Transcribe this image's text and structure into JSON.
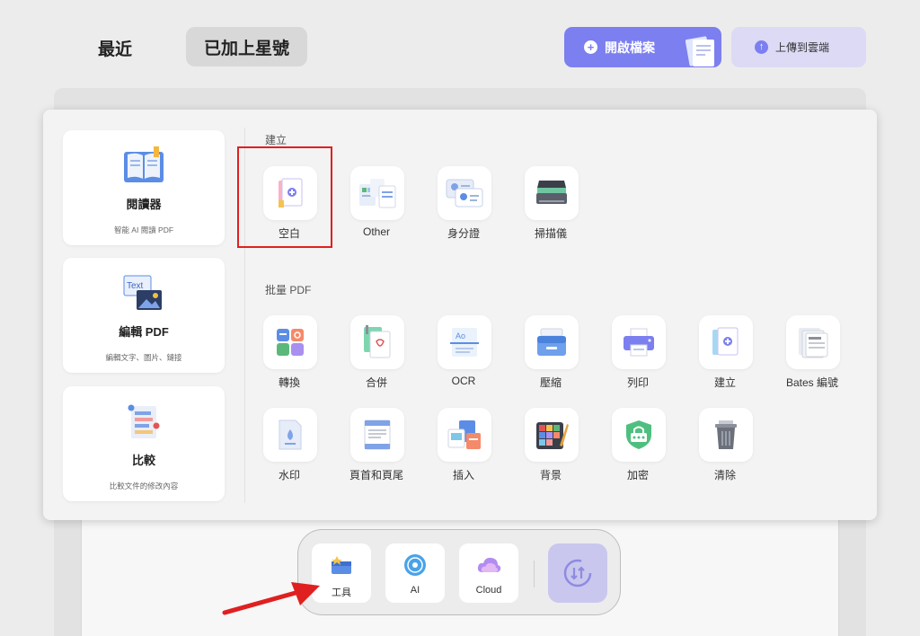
{
  "header": {
    "tab_recent": "最近",
    "tab_starred": "已加上星號",
    "open_file_label": "開啟檔案",
    "upload_cloud_label": "上傳到雲端"
  },
  "sidebar": {
    "cards": [
      {
        "title": "閱讀器",
        "subtitle": "智能 AI 閱讀 PDF",
        "icon": "book-icon"
      },
      {
        "title": "編輯 PDF",
        "subtitle": "編輯文字、圖片、鏈接",
        "icon": "edit-text-image-icon",
        "icon_text": "Text"
      },
      {
        "title": "比較",
        "subtitle": "比較文件的修改內容",
        "icon": "compare-icon"
      }
    ]
  },
  "create": {
    "title": "建立",
    "items": [
      {
        "label": "空白",
        "icon": "blank-doc-icon"
      },
      {
        "label": "Other",
        "icon": "other-forms-icon"
      },
      {
        "label": "身分證",
        "icon": "id-card-icon"
      },
      {
        "label": "掃描儀",
        "icon": "scanner-icon"
      }
    ]
  },
  "batch": {
    "title": "批量 PDF",
    "items": [
      {
        "label": "轉換",
        "icon": "convert-icon"
      },
      {
        "label": "合併",
        "icon": "merge-icon"
      },
      {
        "label": "OCR",
        "icon": "ocr-icon"
      },
      {
        "label": "壓縮",
        "icon": "compress-icon"
      },
      {
        "label": "列印",
        "icon": "printer-icon"
      },
      {
        "label": "建立",
        "icon": "create-doc-icon"
      },
      {
        "label": "Bates 編號",
        "icon": "bates-number-icon"
      },
      {
        "label": "水印",
        "icon": "watermark-icon"
      },
      {
        "label": "頁首和頁尾",
        "icon": "header-footer-icon"
      },
      {
        "label": "插入",
        "icon": "insert-icon"
      },
      {
        "label": "背景",
        "icon": "background-icon"
      },
      {
        "label": "加密",
        "icon": "encrypt-icon"
      },
      {
        "label": "清除",
        "icon": "trash-icon"
      }
    ]
  },
  "dock": {
    "tools_label": "工具",
    "ai_label": "AI",
    "cloud_label": "Cloud"
  },
  "colors": {
    "accent": "#7c7fef",
    "highlight_red": "#e02020",
    "upload_bg": "#dcdaf5"
  }
}
